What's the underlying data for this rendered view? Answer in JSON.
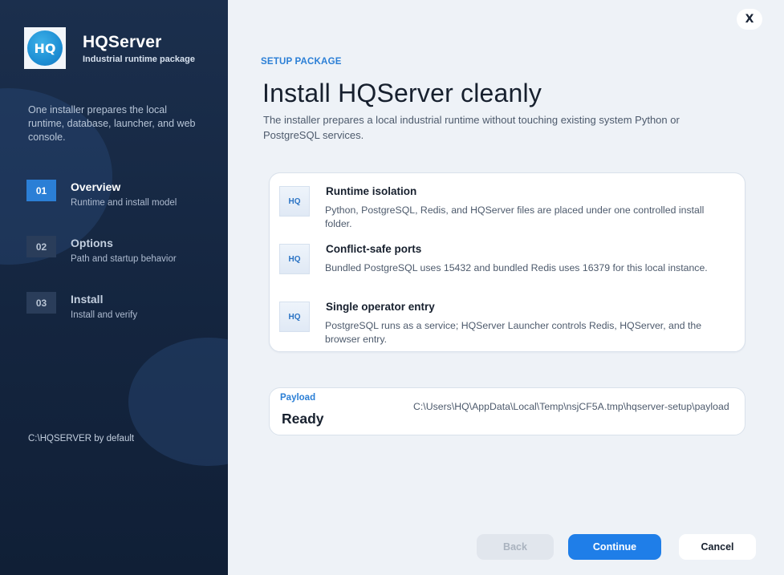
{
  "window": {
    "brand_name": "HQServer",
    "brand_sub": "Industrial runtime package",
    "logo_text": "HQ"
  },
  "sidebar": {
    "description": "One installer prepares the local runtime, database, launcher, and web console.",
    "steps": [
      {
        "number": "01",
        "title": "Overview",
        "subtitle": "Runtime and install model",
        "active": true
      },
      {
        "number": "02",
        "title": "Options",
        "subtitle": "Path and startup behavior",
        "active": false
      },
      {
        "number": "03",
        "title": "Install",
        "subtitle": "Install and verify",
        "active": false
      }
    ],
    "footer": "C:\\HQSERVER by default"
  },
  "main": {
    "close_label": "X",
    "kicker": "SETUP PACKAGE",
    "title": "Install HQServer cleanly",
    "subtitle": "The installer prepares a local industrial runtime without touching existing system Python or PostgreSQL services.",
    "features": [
      {
        "icon": "HQ",
        "title": "Runtime isolation",
        "description": "Python, PostgreSQL, Redis, and HQServer files are placed under one controlled install folder."
      },
      {
        "icon": "HQ",
        "title": "Conflict-safe ports",
        "description": "Bundled PostgreSQL uses 15432 and bundled Redis uses 16379 for this local instance."
      },
      {
        "icon": "HQ",
        "title": "Single operator entry",
        "description": "PostgreSQL runs as a service; HQServer Launcher controls Redis, HQServer, and the browser entry."
      }
    ],
    "payload": {
      "label": "Payload",
      "status": "Ready",
      "path": "C:\\Users\\HQ\\AppData\\Local\\Temp\\nsjCF5A.tmp\\hqserver-setup\\payload"
    }
  },
  "footer_buttons": {
    "back": "Back",
    "continue": "Continue",
    "cancel": "Cancel"
  },
  "colors": {
    "accent": "#2b7fd6",
    "sidebar_bg": "#14253f",
    "continue_bg": "#1f7ee8"
  }
}
